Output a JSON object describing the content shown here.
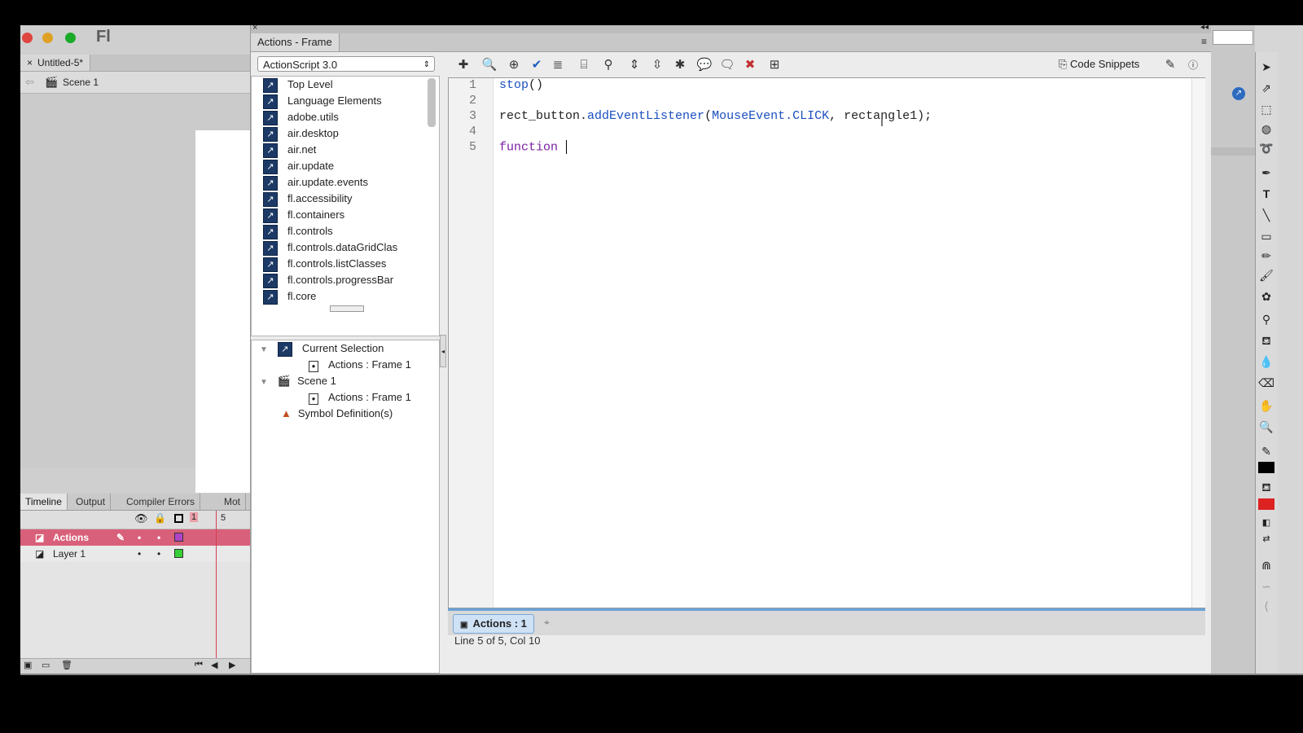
{
  "app": {
    "logo": "Fl"
  },
  "document": {
    "tab_label": "Untitled-5*",
    "scene": "Scene 1"
  },
  "timeline": {
    "tabs": [
      "Timeline",
      "Output",
      "Compiler Errors",
      "Mot"
    ],
    "frame_labels": [
      "1",
      "5"
    ],
    "layers": [
      {
        "name": "Actions",
        "color": "#b044c8"
      },
      {
        "name": "Layer 1",
        "color": "#38d038"
      }
    ]
  },
  "actions_panel": {
    "title": "Actions - Frame",
    "language_select": "ActionScript 3.0",
    "toolbox_items": [
      "Top Level",
      "Language Elements",
      "adobe.utils",
      "air.desktop",
      "air.net",
      "air.update",
      "air.update.events",
      "fl.accessibility",
      "fl.containers",
      "fl.controls",
      "fl.controls.dataGridClas",
      "fl.controls.listClasses",
      "fl.controls.progressBar",
      "fl.core"
    ],
    "script_navigator": {
      "current_selection": "Current Selection",
      "current_selection_child": "Actions : Frame 1",
      "scene": "Scene 1",
      "scene_child": "Actions : Frame 1",
      "symbols": "Symbol Definition(s)"
    },
    "code_snippets_label": "Code Snippets",
    "code": {
      "line_numbers": [
        "1",
        "2",
        "3",
        "4",
        "5"
      ],
      "l1_kw": "stop",
      "l1_rest": "()",
      "l3_obj": "rect_button.",
      "l3_method": "addEventListener",
      "l3_open": "(",
      "l3_const": "MouseEvent.CLICK",
      "l3_rest": ", rectangle1);",
      "l5_kw": "function "
    },
    "script_tab": "Actions : 1",
    "status": "Line 5 of 5, Col 10"
  },
  "colors": {
    "accent": "#6aa3d8",
    "actions_layer": "#d9607a"
  }
}
